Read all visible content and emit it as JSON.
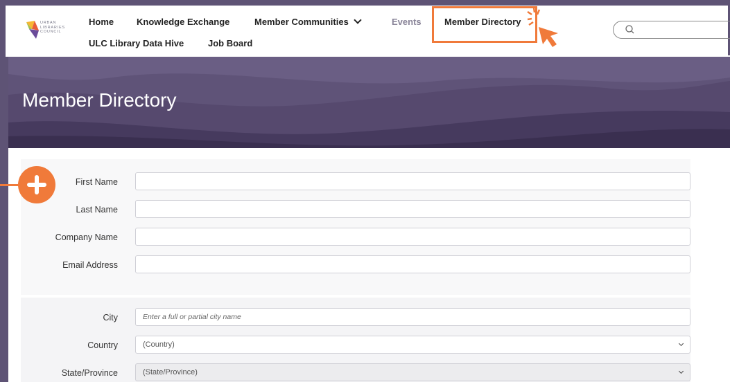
{
  "logo": {
    "text_lines": [
      "URBAN",
      "LIBRARIES",
      "COUNCIL"
    ]
  },
  "nav": {
    "home": "Home",
    "knowledge_exchange": "Knowledge Exchange",
    "member_communities": "Member Communities",
    "events": "Events",
    "member_directory": "Member Directory",
    "ulc_library_data_hive": "ULC Library Data Hive",
    "job_board": "Job Board"
  },
  "banner": {
    "title": "Member Directory"
  },
  "form": {
    "first_name": {
      "label": "First Name",
      "value": ""
    },
    "last_name": {
      "label": "Last Name",
      "value": ""
    },
    "company_name": {
      "label": "Company Name",
      "value": ""
    },
    "email_address": {
      "label": "Email Address",
      "value": ""
    },
    "city": {
      "label": "City",
      "placeholder": "Enter a full or partial city name"
    },
    "country": {
      "label": "Country",
      "selected": "(Country)"
    },
    "state_province": {
      "label": "State/Province",
      "selected": "(State/Province)"
    }
  },
  "icons": {
    "search": "search-icon",
    "add": "plus-icon",
    "cursor": "cursor-pointer-icon",
    "chevron": "chevron-down-icon"
  },
  "colors": {
    "accent_orange": "#f07a3a",
    "banner_purple": "#5e5277",
    "frame_purple": "#5e5375",
    "nav_text": "#222222",
    "nav_muted": "#8a8599"
  }
}
